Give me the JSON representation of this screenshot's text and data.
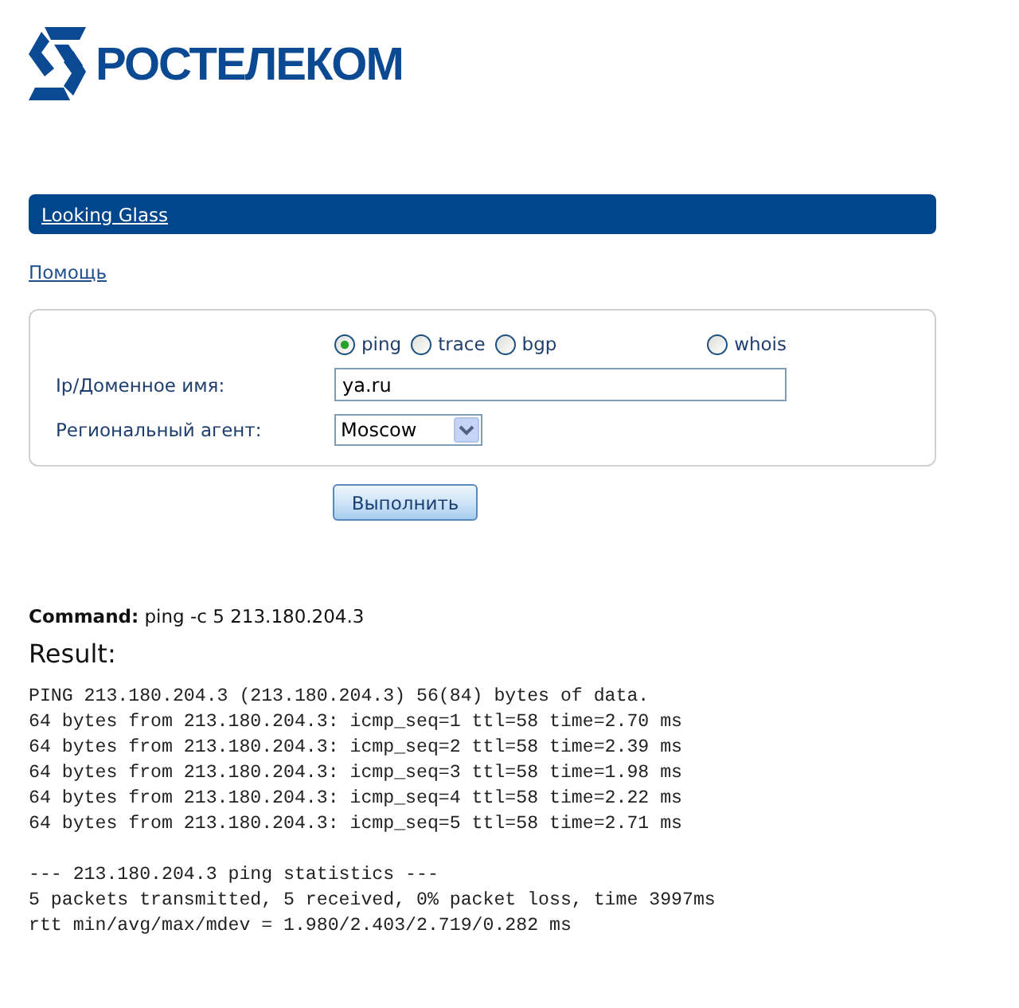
{
  "logo": {
    "text": "РОСТЕЛЕКОМ"
  },
  "nav_bar": {
    "link": "Looking Glass"
  },
  "help_link": "Помощь",
  "form": {
    "query_types": [
      {
        "label": "ping",
        "selected": true
      },
      {
        "label": "trace",
        "selected": false
      },
      {
        "label": "bgp",
        "selected": false
      },
      {
        "label": "whois",
        "selected": false
      }
    ],
    "fields": [
      {
        "kind": "text",
        "label": "Ip/Доменное имя:",
        "value": "ya.ru"
      },
      {
        "kind": "select",
        "label": "Региональный агент:",
        "value": "Moscow"
      }
    ],
    "submit": "Выполнить"
  },
  "command": "**Command:** ping -c 5 213.180.204.3",
  "result": {
    "title": "Result:",
    "blocks": [
      [
        "PING 213.180.204.3 (213.180.204.3) 56(84) bytes of data.",
        "64 bytes from 213.180.204.3: icmp_seq=1 ttl=58 time=2.70 ms",
        "64 bytes from 213.180.204.3: icmp_seq=2 ttl=58 time=2.39 ms",
        "64 bytes from 213.180.204.3: icmp_seq=3 ttl=58 time=1.98 ms",
        "64 bytes from 213.180.204.3: icmp_seq=4 ttl=58 time=2.22 ms",
        "64 bytes from 213.180.204.3: icmp_seq=5 ttl=58 time=2.71 ms"
      ],
      [
        "--- 213.180.204.3 ping statistics ---",
        "5 packets transmitted, 5 received, 0% packet loss, time 3997ms",
        "rtt min/avg/max/mdev = 1.980/2.403/2.719/0.282 ms"
      ]
    ]
  }
}
